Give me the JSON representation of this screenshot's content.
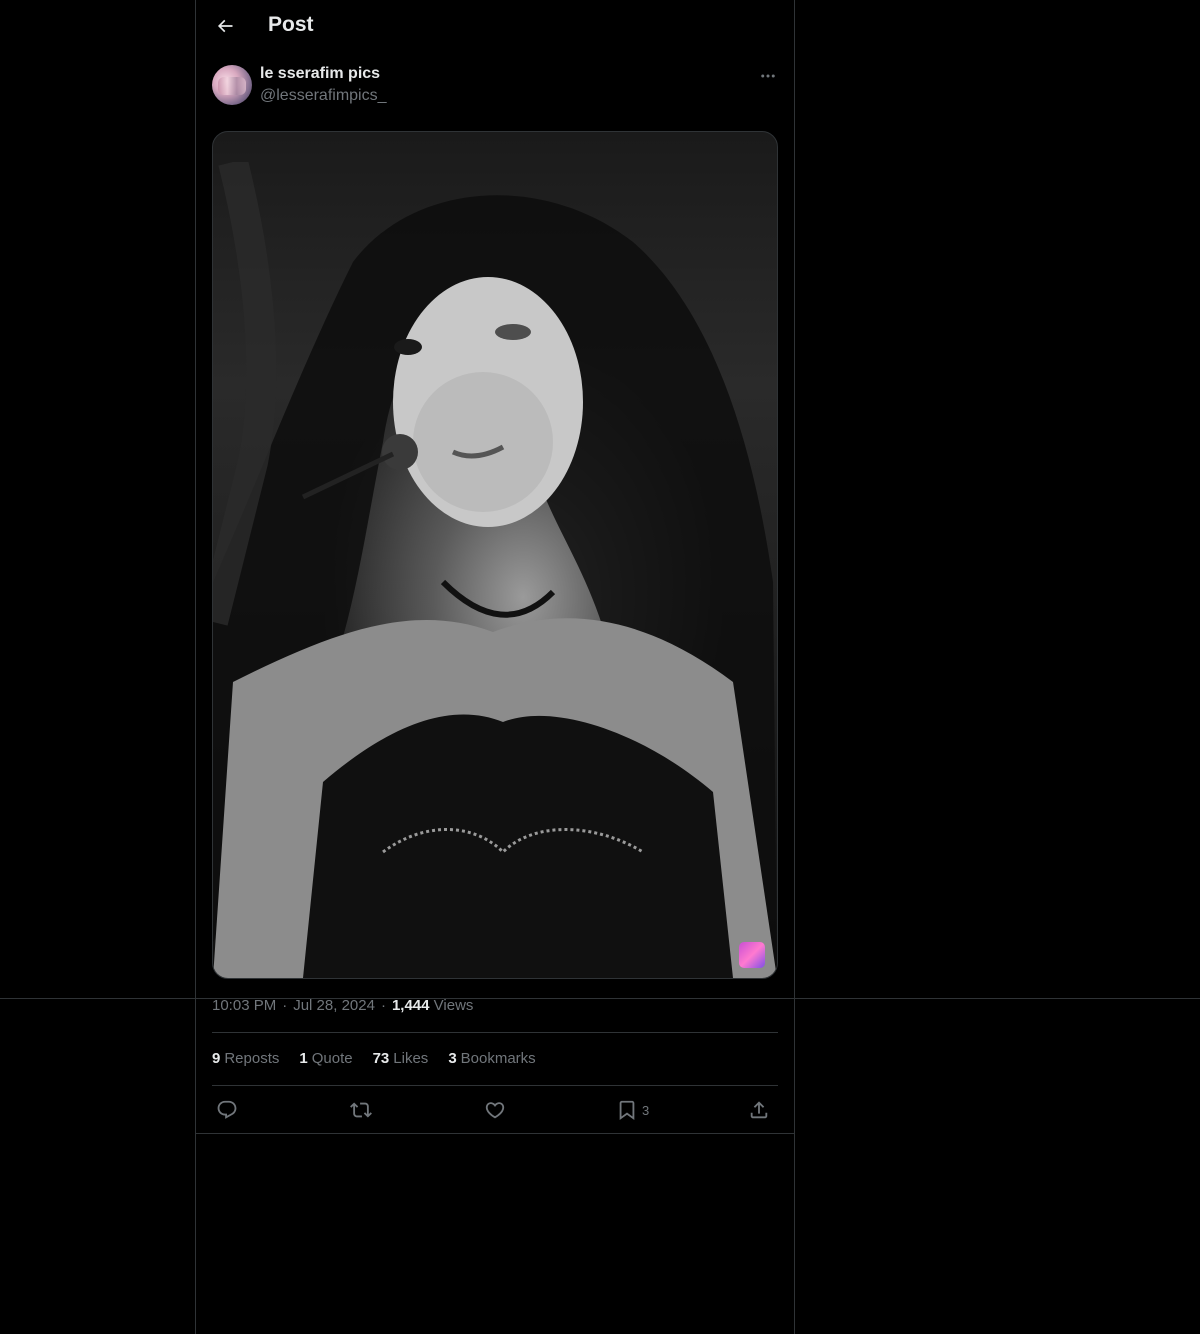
{
  "header": {
    "title": "Post"
  },
  "author": {
    "display_name": "le sserafim pics",
    "handle": "@lesserafimpics_"
  },
  "post": {
    "time": "10:03 PM",
    "date": "Jul 28, 2024",
    "views_count": "1,444",
    "views_label": "Views",
    "separator": "·"
  },
  "stats": {
    "reposts": {
      "count": "9",
      "label": "Reposts"
    },
    "quotes": {
      "count": "1",
      "label": "Quote"
    },
    "likes": {
      "count": "73",
      "label": "Likes"
    },
    "bookmarks": {
      "count": "3",
      "label": "Bookmarks"
    }
  },
  "actions": {
    "bookmark_count": "3",
    "icons": [
      "reply-icon",
      "repost-icon",
      "like-icon",
      "bookmark-icon",
      "share-icon"
    ]
  },
  "colors": {
    "background": "#000000",
    "border": "#2f3336",
    "primary_text": "#e7e9ea",
    "secondary_text": "#71767b"
  }
}
